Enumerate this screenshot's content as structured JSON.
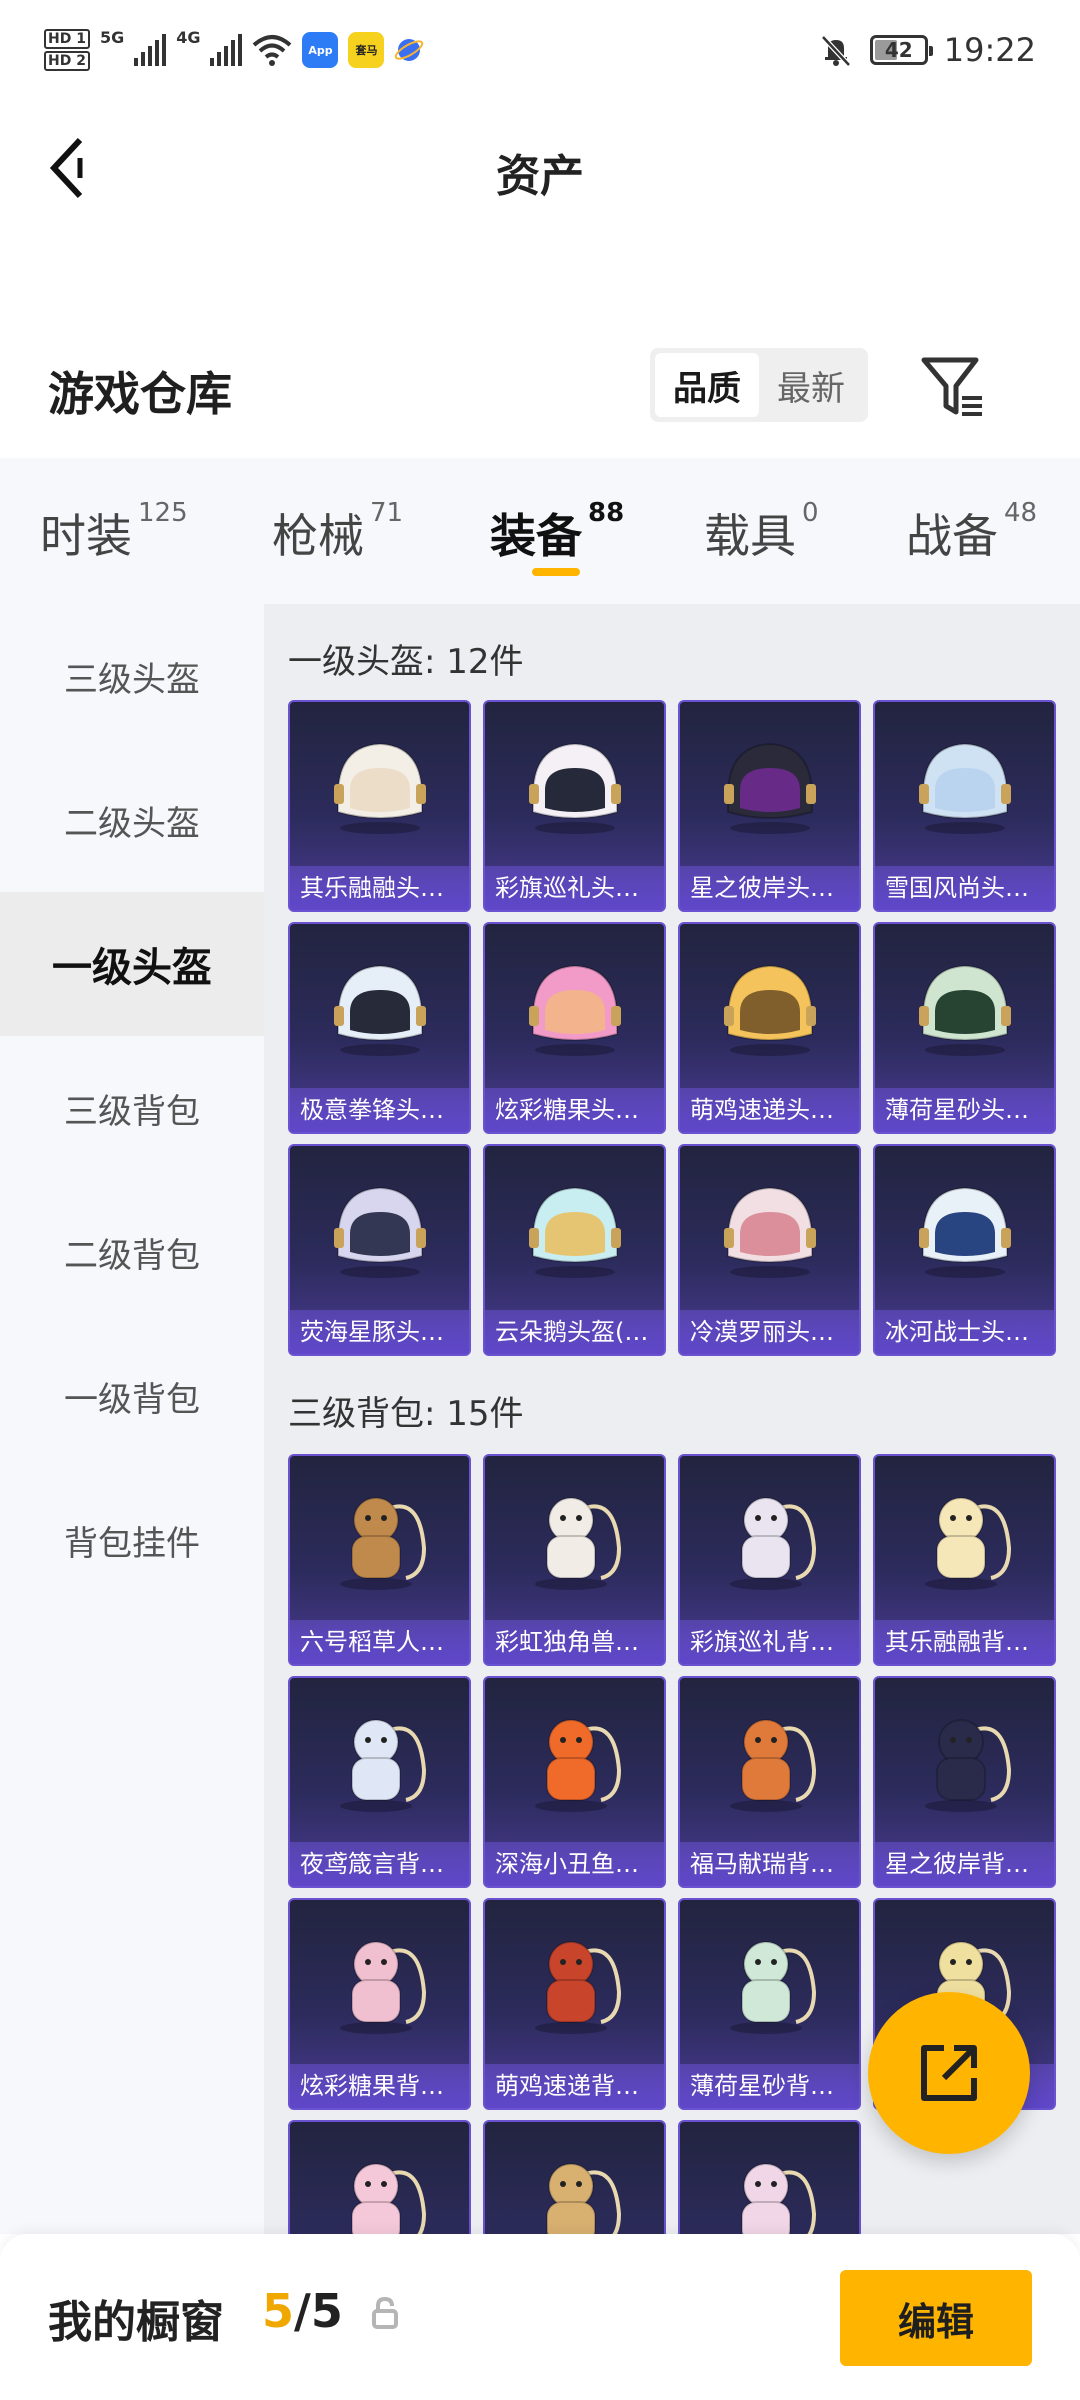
{
  "status_bar": {
    "hd1": "HD 1",
    "hd2": "HD 2",
    "net1": "5G",
    "net2": "4G",
    "app1_label": "App",
    "app2_label": "套马",
    "battery": "42",
    "time": "19:22"
  },
  "header": {
    "title": "资产"
  },
  "warehouse": {
    "title": "游戏仓库",
    "sort_options": [
      "品质",
      "最新"
    ],
    "selected_sort": "品质"
  },
  "tabs": [
    {
      "label": "时装",
      "count": "125"
    },
    {
      "label": "枪械",
      "count": "71"
    },
    {
      "label": "装备",
      "count": "88"
    },
    {
      "label": "载具",
      "count": "0"
    },
    {
      "label": "战备",
      "count": "48"
    }
  ],
  "active_tab": "装备",
  "sidebar": {
    "items": [
      "三级头盔",
      "二级头盔",
      "一级头盔",
      "三级背包",
      "二级背包",
      "一级背包",
      "背包挂件"
    ],
    "active": "一级头盔"
  },
  "sections": [
    {
      "title": "一级头盔: 12件",
      "items": [
        "其乐融融头盔...",
        "彩旗巡礼头盔...",
        "星之彼岸头盔...",
        "雪国风尚头盔...",
        "极意拳锋头盔...",
        "炫彩糖果头盔...",
        "萌鸡速递头盔...",
        "薄荷星砂头盔...",
        "荧海星豚头盔...",
        "云朵鹅头盔(1...",
        "冷漠罗丽头盔...",
        "冰河战士头盔..."
      ]
    },
    {
      "title": "三级背包: 15件",
      "items": [
        "六号稻草人背...",
        "彩虹独角兽背...",
        "彩旗巡礼背包...",
        "其乐融融背包...",
        "夜鸢箴言背包...",
        "深海小丑鱼背...",
        "福马献瑞背包...",
        "星之彼岸背包...",
        "炫彩糖果背包...",
        "萌鸡速递背包...",
        "薄荷星砂背包...",
        "",
        "",
        "",
        ""
      ]
    }
  ],
  "bottom": {
    "showcase_label": "我的橱窗",
    "showcase_current": "5",
    "showcase_sep": "/",
    "showcase_total": "5",
    "edit_label": "编辑"
  },
  "colors": {
    "accent": "#ffb400",
    "card_border": "#6a52d1",
    "card_bg_top": "#22243f",
    "card_bg_bottom": "#4a3b93"
  }
}
